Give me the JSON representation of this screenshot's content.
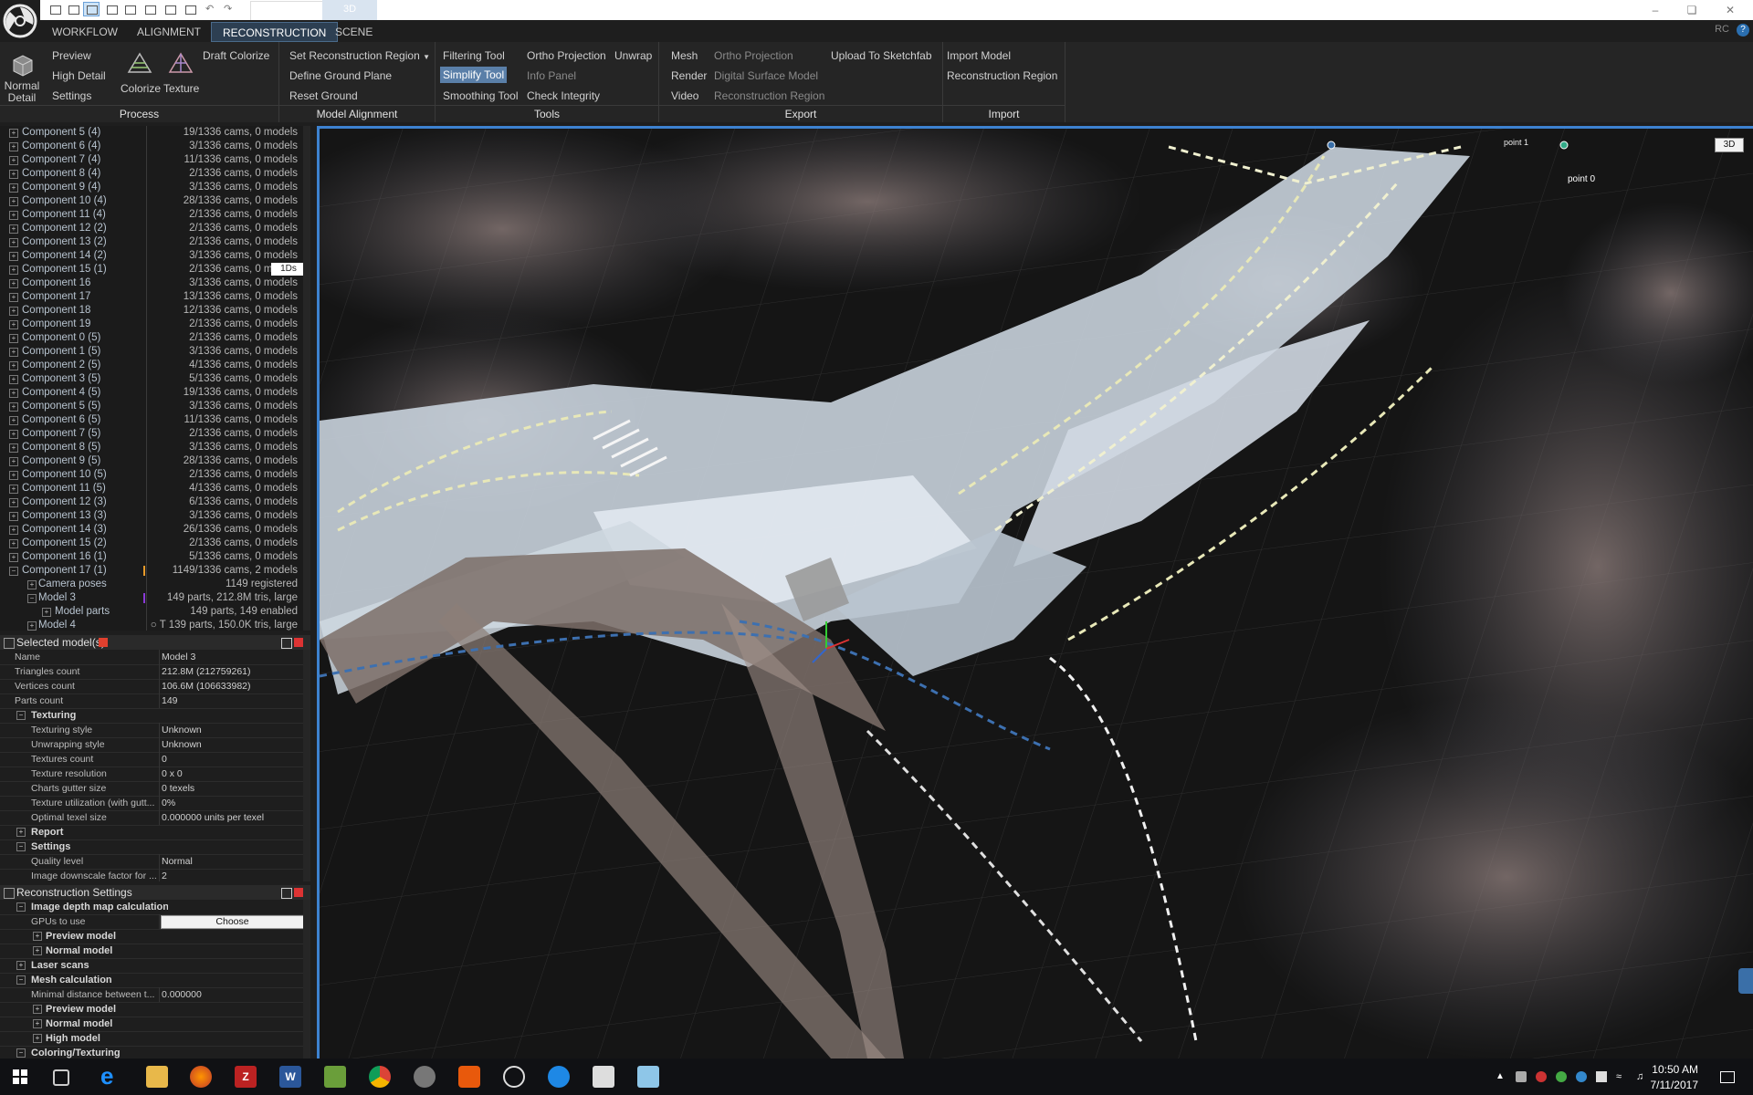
{
  "titlebar": {
    "tab_3d": "3D"
  },
  "ribbon_tabs": [
    "WORKFLOW",
    "ALIGNMENT",
    "RECONSTRUCTION",
    "SCENE"
  ],
  "rc_label": "RC",
  "ribbon": {
    "process": {
      "label": "Process",
      "normal_detail": "Normal\nDetail",
      "preview": "Preview",
      "high_detail": "High Detail",
      "settings": "Settings",
      "colorize": "Colorize",
      "texture": "Texture",
      "draft_colorize": "Draft Colorize"
    },
    "model_alignment": {
      "label": "Model Alignment",
      "set_region": "Set Reconstruction Region",
      "define_ground": "Define Ground Plane",
      "reset_ground": "Reset Ground"
    },
    "tools": {
      "label": "Tools",
      "filtering": "Filtering Tool",
      "simplify": "Simplify Tool",
      "smoothing": "Smoothing Tool",
      "ortho": "Ortho Projection",
      "info_panel": "Info Panel",
      "check_integrity": "Check Integrity",
      "unwrap": "Unwrap"
    },
    "export": {
      "label": "Export",
      "mesh": "Mesh",
      "render": "Render",
      "video": "Video",
      "ortho": "Ortho Projection",
      "dsm": "Digital Surface Model",
      "recon_region": "Reconstruction Region",
      "sketchfab": "Upload To Sketchfab"
    },
    "import": {
      "label": "Import",
      "import_model": "Import Model",
      "recon_region": "Reconstruction Region"
    }
  },
  "tree": {
    "tag": "1Ds",
    "rows": [
      {
        "name": "Component 5 (4)",
        "info": "19/1336 cams, 0 models",
        "lvl": 0,
        "pm": "+"
      },
      {
        "name": "Component 6 (4)",
        "info": "3/1336 cams, 0 models",
        "lvl": 0,
        "pm": "+"
      },
      {
        "name": "Component 7 (4)",
        "info": "11/1336 cams, 0 models",
        "lvl": 0,
        "pm": "+"
      },
      {
        "name": "Component 8 (4)",
        "info": "2/1336 cams, 0 models",
        "lvl": 0,
        "pm": "+"
      },
      {
        "name": "Component 9 (4)",
        "info": "3/1336 cams, 0 models",
        "lvl": 0,
        "pm": "+"
      },
      {
        "name": "Component 10 (4)",
        "info": "28/1336 cams, 0 models",
        "lvl": 0,
        "pm": "+"
      },
      {
        "name": "Component 11 (4)",
        "info": "2/1336 cams, 0 models",
        "lvl": 0,
        "pm": "+"
      },
      {
        "name": "Component 12 (2)",
        "info": "2/1336 cams, 0 models",
        "lvl": 0,
        "pm": "+"
      },
      {
        "name": "Component 13 (2)",
        "info": "2/1336 cams, 0 models",
        "lvl": 0,
        "pm": "+"
      },
      {
        "name": "Component 14 (2)",
        "info": "3/1336 cams, 0 models",
        "lvl": 0,
        "pm": "+"
      },
      {
        "name": "Component 15 (1)",
        "info": "2/1336 cams, 0 models",
        "lvl": 0,
        "pm": "+"
      },
      {
        "name": "Component 16",
        "info": "3/1336 cams, 0 models",
        "lvl": 0,
        "pm": "+"
      },
      {
        "name": "Component 17",
        "info": "13/1336 cams, 0 models",
        "lvl": 0,
        "pm": "+"
      },
      {
        "name": "Component 18",
        "info": "12/1336 cams, 0 models",
        "lvl": 0,
        "pm": "+"
      },
      {
        "name": "Component 19",
        "info": "2/1336 cams, 0 models",
        "lvl": 0,
        "pm": "+"
      },
      {
        "name": "Component 0 (5)",
        "info": "2/1336 cams, 0 models",
        "lvl": 0,
        "pm": "+"
      },
      {
        "name": "Component 1 (5)",
        "info": "3/1336 cams, 0 models",
        "lvl": 0,
        "pm": "+"
      },
      {
        "name": "Component 2 (5)",
        "info": "4/1336 cams, 0 models",
        "lvl": 0,
        "pm": "+"
      },
      {
        "name": "Component 3 (5)",
        "info": "5/1336 cams, 0 models",
        "lvl": 0,
        "pm": "+"
      },
      {
        "name": "Component 4 (5)",
        "info": "19/1336 cams, 0 models",
        "lvl": 0,
        "pm": "+"
      },
      {
        "name": "Component 5 (5)",
        "info": "3/1336 cams, 0 models",
        "lvl": 0,
        "pm": "+"
      },
      {
        "name": "Component 6 (5)",
        "info": "11/1336 cams, 0 models",
        "lvl": 0,
        "pm": "+"
      },
      {
        "name": "Component 7 (5)",
        "info": "2/1336 cams, 0 models",
        "lvl": 0,
        "pm": "+"
      },
      {
        "name": "Component 8 (5)",
        "info": "3/1336 cams, 0 models",
        "lvl": 0,
        "pm": "+"
      },
      {
        "name": "Component 9 (5)",
        "info": "28/1336 cams, 0 models",
        "lvl": 0,
        "pm": "+"
      },
      {
        "name": "Component 10 (5)",
        "info": "2/1336 cams, 0 models",
        "lvl": 0,
        "pm": "+"
      },
      {
        "name": "Component 11 (5)",
        "info": "4/1336 cams, 0 models",
        "lvl": 0,
        "pm": "+"
      },
      {
        "name": "Component 12 (3)",
        "info": "6/1336 cams, 0 models",
        "lvl": 0,
        "pm": "+"
      },
      {
        "name": "Component 13 (3)",
        "info": "3/1336 cams, 0 models",
        "lvl": 0,
        "pm": "+"
      },
      {
        "name": "Component 14 (3)",
        "info": "26/1336 cams, 0 models",
        "lvl": 0,
        "pm": "+"
      },
      {
        "name": "Component 15 (2)",
        "info": "2/1336 cams, 0 models",
        "lvl": 0,
        "pm": "+"
      },
      {
        "name": "Component 16 (1)",
        "info": "5/1336 cams, 0 models",
        "lvl": 0,
        "pm": "+"
      },
      {
        "name": "Component 17 (1)",
        "info": "1149/1336 cams, 2 models",
        "lvl": 0,
        "pm": "−"
      },
      {
        "name": "Camera poses",
        "info": "1149 registered",
        "lvl": 1,
        "pm": "+"
      },
      {
        "name": "Model 3",
        "info": "149 parts, 212.8M tris, large",
        "lvl": 1,
        "pm": "−"
      },
      {
        "name": "Model parts",
        "info": "149 parts, 149 enabled",
        "lvl": 2,
        "pm": "+"
      },
      {
        "name": "Model 4",
        "info": "○ T 139 parts, 150.0K tris, large",
        "lvl": 1,
        "pm": "+"
      }
    ]
  },
  "selected_models": {
    "title": "Selected model(s)",
    "rows": [
      {
        "k": "Name",
        "v": "Model 3",
        "t": "row"
      },
      {
        "k": "Triangles count",
        "v": "212.8M (212759261)",
        "t": "row"
      },
      {
        "k": "Vertices count",
        "v": "106.6M (106633982)",
        "t": "row"
      },
      {
        "k": "Parts count",
        "v": "149",
        "t": "row"
      },
      {
        "k": "Texturing",
        "v": "",
        "t": "sec",
        "box": "−"
      },
      {
        "k": "Texturing style",
        "v": "Unknown",
        "t": "sub"
      },
      {
        "k": "Unwrapping style",
        "v": "Unknown",
        "t": "sub"
      },
      {
        "k": "Textures count",
        "v": "0",
        "t": "sub"
      },
      {
        "k": "Texture resolution",
        "v": "0 x 0",
        "t": "sub"
      },
      {
        "k": "Charts gutter size",
        "v": "0 texels",
        "t": "sub"
      },
      {
        "k": "Texture utilization (with gutt...",
        "v": "0%",
        "t": "sub"
      },
      {
        "k": "Optimal texel size",
        "v": "0.000000 units per texel",
        "t": "sub"
      },
      {
        "k": "Report",
        "v": "",
        "t": "sec",
        "box": "+"
      },
      {
        "k": "Settings",
        "v": "",
        "t": "sec",
        "box": "−"
      },
      {
        "k": "Quality level",
        "v": "Normal",
        "t": "sub"
      },
      {
        "k": "Image downscale factor for ...",
        "v": "2",
        "t": "sub"
      }
    ]
  },
  "recon_settings": {
    "title": "Reconstruction Settings",
    "choose_label": "Choose",
    "rows": [
      {
        "k": "Image depth map calculation",
        "v": "",
        "t": "sec",
        "box": "−"
      },
      {
        "k": "GPUs to use",
        "v": "",
        "t": "sub",
        "choose": true
      },
      {
        "k": "Preview model",
        "v": "",
        "t": "sec2",
        "box": "+"
      },
      {
        "k": "Normal model",
        "v": "",
        "t": "sec2",
        "box": "+"
      },
      {
        "k": "Laser scans",
        "v": "",
        "t": "sec",
        "box": "+"
      },
      {
        "k": "Mesh calculation",
        "v": "",
        "t": "sec",
        "box": "−"
      },
      {
        "k": "Minimal distance between t...",
        "v": "0.000000",
        "t": "sub"
      },
      {
        "k": "Preview model",
        "v": "",
        "t": "sec2",
        "box": "+"
      },
      {
        "k": "Normal model",
        "v": "",
        "t": "sec2",
        "box": "+"
      },
      {
        "k": "High model",
        "v": "",
        "t": "sec2",
        "box": "+"
      },
      {
        "k": "Coloring/Texturing",
        "v": "",
        "t": "sec",
        "box": "−"
      }
    ]
  },
  "viewport": {
    "badge": "3D",
    "point_label": "point 0",
    "point_label_2": "point 1"
  },
  "taskbar": {
    "time": "10:50 AM",
    "date": "7/11/2017"
  },
  "colors": {
    "accent": "#3d82d0",
    "ribbon_bg": "#252525",
    "panel_bg": "#1e1e1e"
  }
}
